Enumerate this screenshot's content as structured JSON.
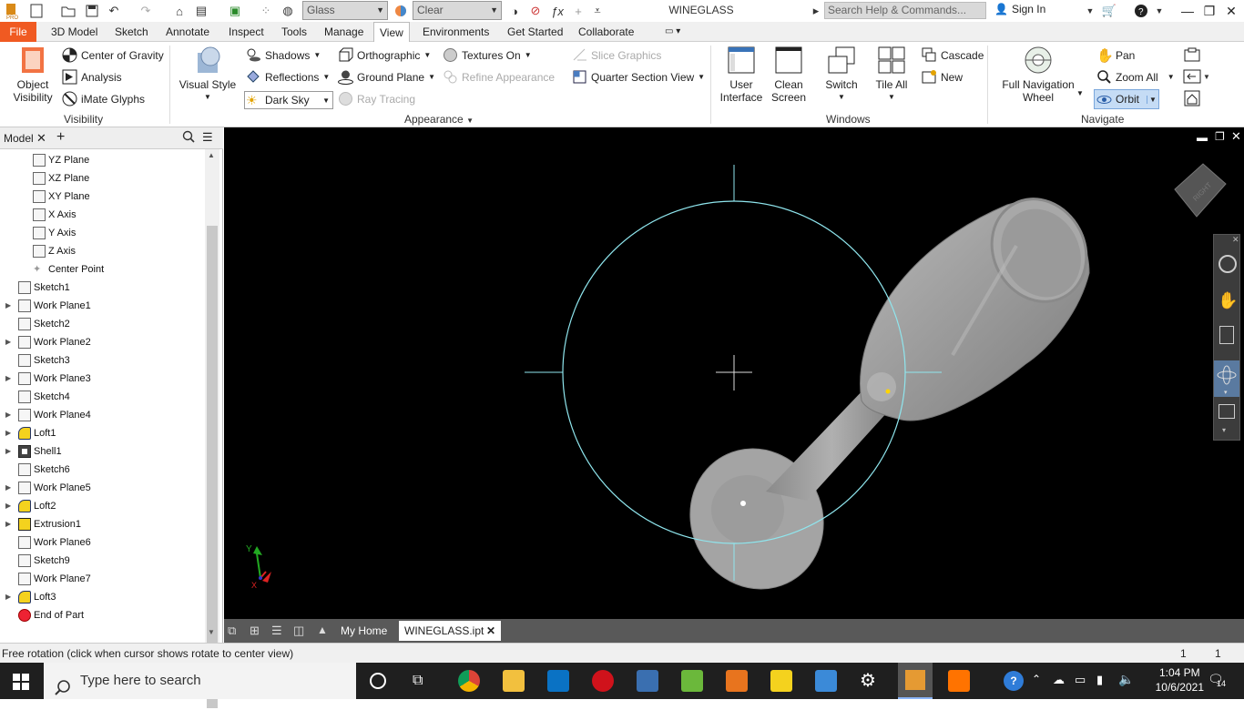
{
  "titlebar": {
    "material_value": "Glass",
    "appearance_value": "Clear",
    "app_title": "WINEGLASS",
    "search_placeholder": "Search Help & Commands...",
    "signin_label": "Sign In"
  },
  "menu": {
    "items": [
      "File",
      "3D Model",
      "Sketch",
      "Annotate",
      "Inspect",
      "Tools",
      "Manage",
      "View",
      "Environments",
      "Get Started",
      "Collaborate"
    ],
    "active": "View"
  },
  "ribbon": {
    "visibility": {
      "object_visibility": "Object\nVisibility",
      "center_of_gravity": "Center of Gravity",
      "analysis": "Analysis",
      "imate_glyphs": "iMate Glyphs",
      "label": "Visibility"
    },
    "appearance": {
      "visual_style": "Visual Style",
      "shadows": "Shadows",
      "reflections": "Reflections",
      "dark_sky": "Dark Sky",
      "orthographic": "Orthographic",
      "ground_plane": "Ground Plane",
      "ray_tracing": "Ray Tracing",
      "textures_on": "Textures On",
      "refine_appearance": "Refine Appearance",
      "slice_graphics": "Slice Graphics",
      "quarter_section_view": "Quarter Section View",
      "label": "Appearance"
    },
    "windows": {
      "user_interface": "User\nInterface",
      "clean_screen": "Clean\nScreen",
      "switch": "Switch",
      "tile_all": "Tile All",
      "cascade": "Cascade",
      "new": "New",
      "label": "Windows"
    },
    "navigate": {
      "full_nav_wheel": "Full Navigation\nWheel",
      "pan": "Pan",
      "zoom_all": "Zoom All",
      "orbit": "Orbit",
      "label": "Navigate"
    }
  },
  "browser": {
    "tab_label": "Model",
    "items": [
      {
        "label": "YZ Plane",
        "icon": "plane-icon",
        "indent": 2,
        "expand": false
      },
      {
        "label": "XZ Plane",
        "icon": "plane-icon",
        "indent": 2,
        "expand": false
      },
      {
        "label": "XY Plane",
        "icon": "plane-icon",
        "indent": 2,
        "expand": false
      },
      {
        "label": "X Axis",
        "icon": "axis-icon",
        "indent": 2,
        "expand": false
      },
      {
        "label": "Y Axis",
        "icon": "axis-icon",
        "indent": 2,
        "expand": false
      },
      {
        "label": "Z Axis",
        "icon": "axis-icon",
        "indent": 2,
        "expand": false
      },
      {
        "label": "Center Point",
        "icon": "point-icon",
        "indent": 2,
        "expand": false
      },
      {
        "label": "Sketch1",
        "icon": "sketch-icon",
        "indent": 1,
        "expand": false
      },
      {
        "label": "Work Plane1",
        "icon": "plane-icon",
        "indent": 1,
        "expand": true
      },
      {
        "label": "Sketch2",
        "icon": "sketch-icon",
        "indent": 1,
        "expand": false
      },
      {
        "label": "Work Plane2",
        "icon": "plane-icon",
        "indent": 1,
        "expand": true
      },
      {
        "label": "Sketch3",
        "icon": "sketch-icon",
        "indent": 1,
        "expand": false
      },
      {
        "label": "Work Plane3",
        "icon": "plane-icon",
        "indent": 1,
        "expand": true
      },
      {
        "label": "Sketch4",
        "icon": "sketch-icon",
        "indent": 1,
        "expand": false
      },
      {
        "label": "Work Plane4",
        "icon": "plane-icon",
        "indent": 1,
        "expand": true
      },
      {
        "label": "Loft1",
        "icon": "loft-icon",
        "indent": 1,
        "expand": true
      },
      {
        "label": "Shell1",
        "icon": "shell-icon",
        "indent": 1,
        "expand": true
      },
      {
        "label": "Sketch6",
        "icon": "sketch-icon",
        "indent": 1,
        "expand": false
      },
      {
        "label": "Work Plane5",
        "icon": "plane-icon",
        "indent": 1,
        "expand": true
      },
      {
        "label": "Loft2",
        "icon": "loft-icon",
        "indent": 1,
        "expand": true
      },
      {
        "label": "Extrusion1",
        "icon": "extrusion-icon",
        "indent": 1,
        "expand": true
      },
      {
        "label": "Work Plane6",
        "icon": "plane-icon",
        "indent": 1,
        "expand": false
      },
      {
        "label": "Sketch9",
        "icon": "sketch-icon",
        "indent": 1,
        "expand": false
      },
      {
        "label": "Work Plane7",
        "icon": "plane-icon",
        "indent": 1,
        "expand": false
      },
      {
        "label": "Loft3",
        "icon": "loft-icon",
        "indent": 1,
        "expand": true
      },
      {
        "label": "End of Part",
        "icon": "end-of-part-icon",
        "indent": 1,
        "expand": false
      }
    ]
  },
  "viewport": {
    "triad_y_label": "Y",
    "triad_x_label": "X",
    "viewcube_label": "RIGHT"
  },
  "doctabs": {
    "home_label": "My Home",
    "file_label": "WINEGLASS.ipt"
  },
  "status": {
    "message": "Free rotation (click when cursor shows rotate to center view)",
    "count1": "1",
    "count2": "1"
  },
  "taskbar": {
    "search_placeholder": "Type here to search",
    "time": "1:04 PM",
    "date": "10/6/2021",
    "notifications": "14"
  },
  "colors": {
    "file_tab": "#f05a22",
    "orbit_active": "#c5dcf5",
    "viewport_bg": "#000000",
    "sketch_circle": "#8fe6ee"
  }
}
